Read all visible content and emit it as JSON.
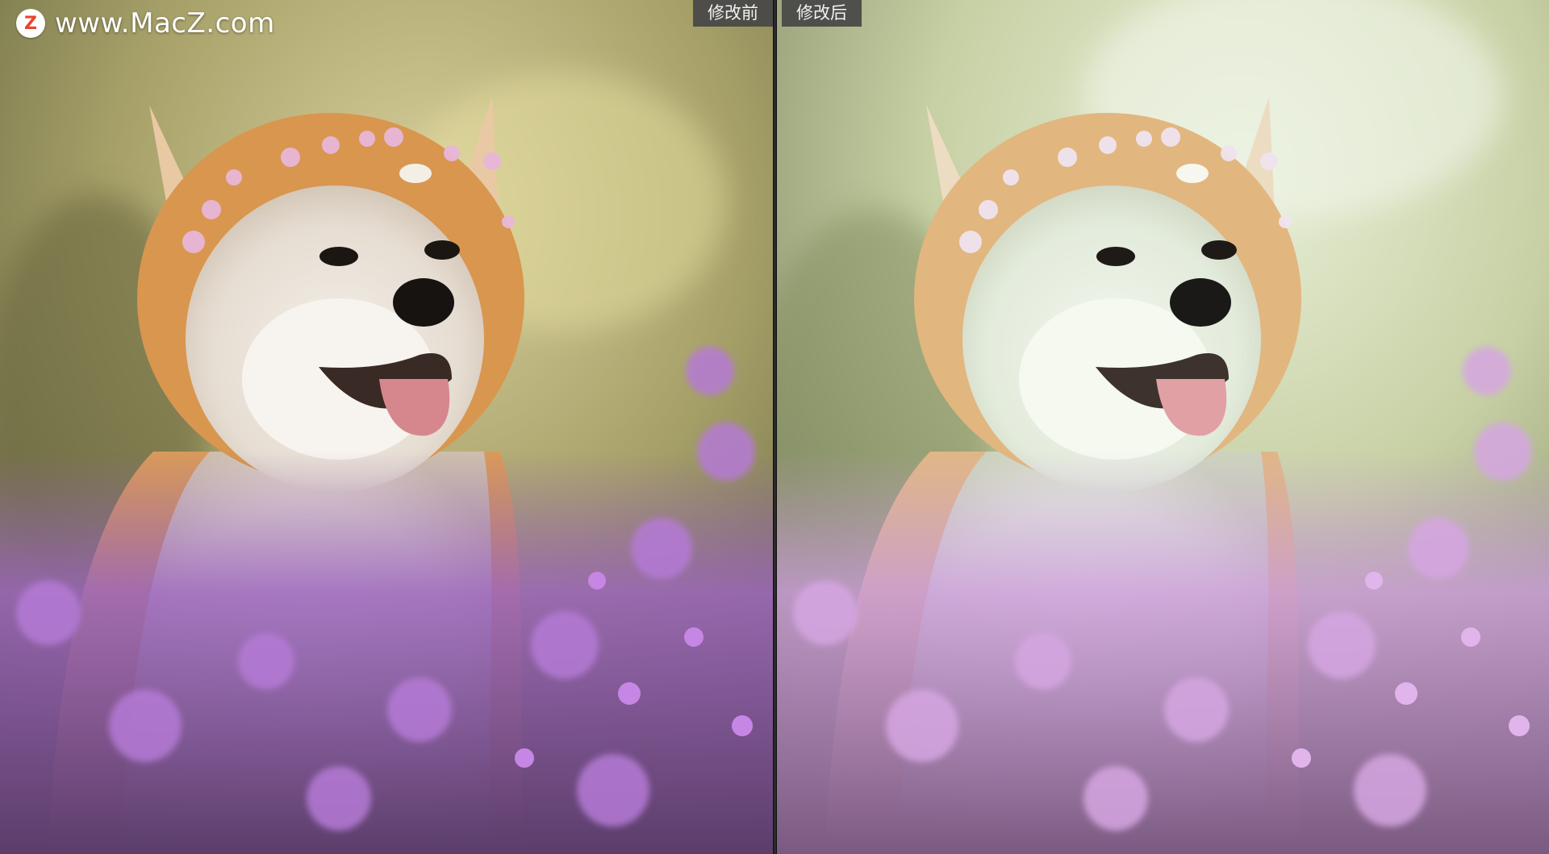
{
  "watermark": {
    "logo_letter": "Z",
    "site": "www.MacZ.com",
    "logo_color": "#e8452c"
  },
  "panes": {
    "before": {
      "label": "修改前"
    },
    "after": {
      "label": "修改后"
    }
  },
  "colors": {
    "label_bg": "#464646",
    "divider": "#2a2a2a",
    "flower_purple": "#a96ad0",
    "fur_orange": "#d99a5a"
  }
}
